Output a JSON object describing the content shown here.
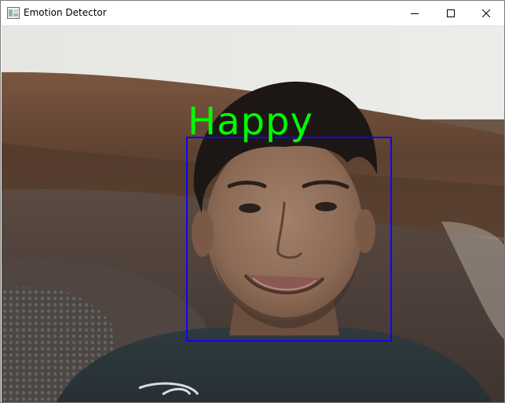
{
  "window": {
    "title": "Emotion Detector",
    "icon": "opencv-window-icon"
  },
  "controls": {
    "minimize_icon": "minimize-icon",
    "maximize_icon": "maximize-icon",
    "close_icon": "close-icon"
  },
  "detection": {
    "emotion_label": "Happy",
    "label_color": "#00ff00",
    "box_color": "#1400ff"
  }
}
